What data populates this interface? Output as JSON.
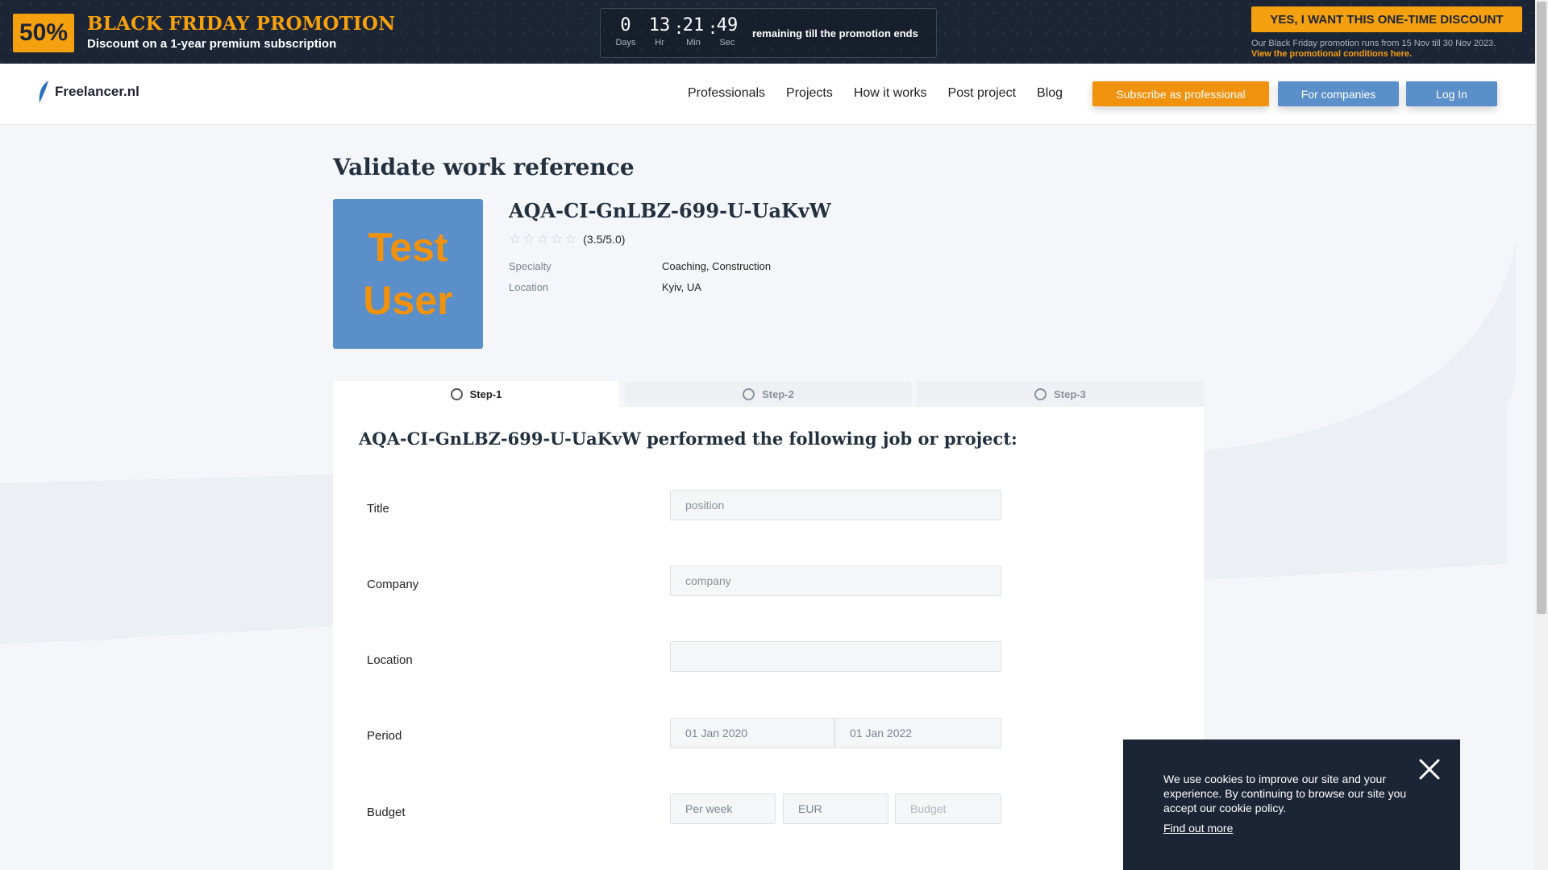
{
  "promo": {
    "badge": "50%",
    "title": "BLACK FRIDAY PROMOTION",
    "subtitle": "Discount on a 1-year premium subscription",
    "timer": {
      "days": "0",
      "hours": "13",
      "minutes": "21",
      "seconds": "49",
      "days_label": "Days",
      "hours_label": "Hr",
      "minutes_label": "Min",
      "seconds_label": "Sec",
      "remaining_text": "remaining till the promotion ends"
    },
    "cta_label": "YES, I WANT THIS ONE-TIME DISCOUNT",
    "note": "Our Black Friday promotion runs from 15 Nov till 30 Nov 2023.",
    "conditions_link": "View the promotional conditions here."
  },
  "nav": {
    "logo": "Freelancer.nl",
    "links": [
      "Professionals",
      "Projects",
      "How it works",
      "Post project",
      "Blog"
    ],
    "subscribe_label": "Subscribe as professional",
    "companies_label": "For companies",
    "login_label": "Log In"
  },
  "page": {
    "title": "Validate work reference"
  },
  "profile": {
    "avatar_line1": "Test",
    "avatar_line2": "User",
    "name": "AQA-CI-GnLBZ-699-U-UaKvW",
    "rating_text": "(3.5/5.0)",
    "rating_value": 3.5,
    "specialty_label": "Specialty",
    "specialty_value": "Coaching, Construction",
    "location_label": "Location",
    "location_value": "Kyiv, UA"
  },
  "steps": [
    "Step-1",
    "Step-2",
    "Step-3"
  ],
  "form": {
    "title": "AQA-CI-GnLBZ-699-U-UaKvW performed the following job or project:",
    "title_label": "Title",
    "title_placeholder": "position",
    "company_label": "Company",
    "company_placeholder": "company",
    "location_label": "Location",
    "location_placeholder": "",
    "period_label": "Period",
    "period_from": "01 Jan 2020",
    "period_to": "01 Jan 2022",
    "budget_label": "Budget",
    "budget_frequency": "Per week",
    "budget_currency": "EUR",
    "budget_placeholder": "Budget"
  },
  "cookie": {
    "text": "We use cookies to improve our site and your experience. By continuing to browse our site you accept our cookie policy.",
    "link": "Find out more"
  },
  "colors": {
    "accent_orange": "#f5a00f",
    "primary_blue": "#5a8fc9",
    "dark_navy": "#1c2535"
  }
}
